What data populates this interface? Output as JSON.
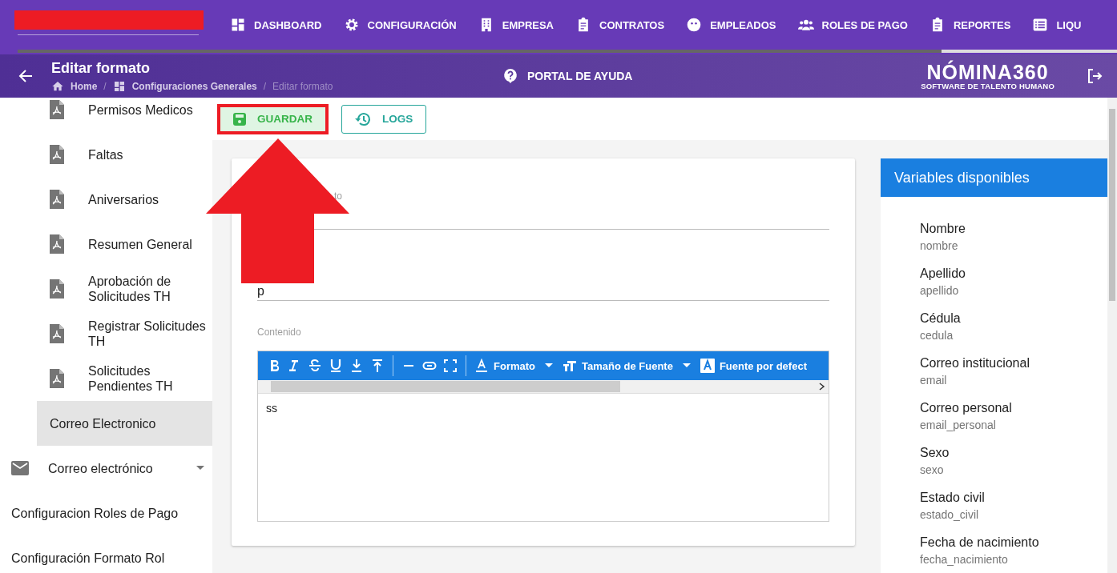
{
  "nav": {
    "items": [
      {
        "kind": "dashboard",
        "label": "DASHBOARD"
      },
      {
        "kind": "gear",
        "label": "CONFIGURACIÓN"
      },
      {
        "kind": "building",
        "label": "EMPRESA"
      },
      {
        "kind": "clipboard",
        "label": "CONTRATOS"
      },
      {
        "kind": "face",
        "label": "EMPLEADOS"
      },
      {
        "kind": "people",
        "label": "ROLES DE PAGO"
      },
      {
        "kind": "clipboard",
        "label": "REPORTES"
      },
      {
        "kind": "list",
        "label": "LIQU"
      }
    ]
  },
  "header": {
    "title": "Editar formato",
    "breadcrumbs": [
      {
        "kind": "home",
        "label": "Home"
      },
      {
        "kind": "dashboard",
        "label": "Configuraciones Generales",
        "separator": "/"
      },
      {
        "kind": "current",
        "label": "Editar formato",
        "separator": "/"
      }
    ],
    "help": "PORTAL DE AYUDA",
    "logo": "NÓMINA360",
    "tagline": "SOFTWARE DE TALENTO HUMANO"
  },
  "sidebar": {
    "items": [
      {
        "kind": "pdf",
        "label": "Permisos Medicos",
        "selected": false
      },
      {
        "kind": "pdf",
        "label": "Faltas",
        "selected": false
      },
      {
        "kind": "pdf",
        "label": "Aniversarios",
        "selected": false
      },
      {
        "kind": "pdf",
        "label": "Resumen General",
        "selected": false
      },
      {
        "kind": "pdf",
        "label": "Aprobación de Solicitudes TH",
        "selected": false
      },
      {
        "kind": "pdf",
        "label": "Registrar Solicitudes TH",
        "selected": false
      },
      {
        "kind": "pdf",
        "label": "Solicitudes Pendientes TH",
        "selected": false
      },
      {
        "kind": "sub",
        "label": "Correo Electronico",
        "selected": true
      },
      {
        "kind": "mail",
        "label": "Correo electrónico",
        "selected": false,
        "expanded": false
      },
      {
        "kind": "toplevel",
        "label": "Configuracion Roles de Pago",
        "selected": false
      },
      {
        "kind": "toplevel",
        "label": "Configuración Formato Rol",
        "selected": false
      }
    ]
  },
  "actions": [
    {
      "kind": "save",
      "label": "GUARDAR",
      "highlighted": true
    },
    {
      "kind": "history",
      "label": "LOGS",
      "highlighted": false
    }
  ],
  "form": {
    "fields": [
      {
        "label": "to"
      },
      {
        "value": "p"
      }
    ],
    "content_label": "Contenido",
    "toolbar": {
      "buttons": [
        {
          "kind": "bold"
        },
        {
          "kind": "italic"
        },
        {
          "kind": "strike"
        },
        {
          "kind": "underline"
        },
        {
          "kind": "down"
        },
        {
          "kind": "up"
        },
        {
          "kind": "sep"
        },
        {
          "kind": "rule"
        },
        {
          "kind": "link"
        },
        {
          "kind": "fullscreen"
        },
        {
          "kind": "sep"
        }
      ],
      "dropdowns": [
        {
          "kind": "format",
          "label": "Formato"
        },
        {
          "kind": "size",
          "label": "Tamaño de Fuente"
        },
        {
          "kind": "font",
          "label": "Fuente por defect"
        }
      ]
    },
    "content": "ss"
  },
  "variables": {
    "title": "Variables disponibles",
    "items": [
      {
        "label": "Nombre",
        "key": "nombre"
      },
      {
        "label": "Apellido",
        "key": "apellido"
      },
      {
        "label": "Cédula",
        "key": "cedula"
      },
      {
        "label": "Correo institucional",
        "key": "email"
      },
      {
        "label": "Correo personal",
        "key": "email_personal"
      },
      {
        "label": "Sexo",
        "key": "sexo"
      },
      {
        "label": "Estado civil",
        "key": "estado_civil"
      },
      {
        "label": "Fecha de nacimiento",
        "key": "fecha_nacimiento"
      }
    ]
  }
}
